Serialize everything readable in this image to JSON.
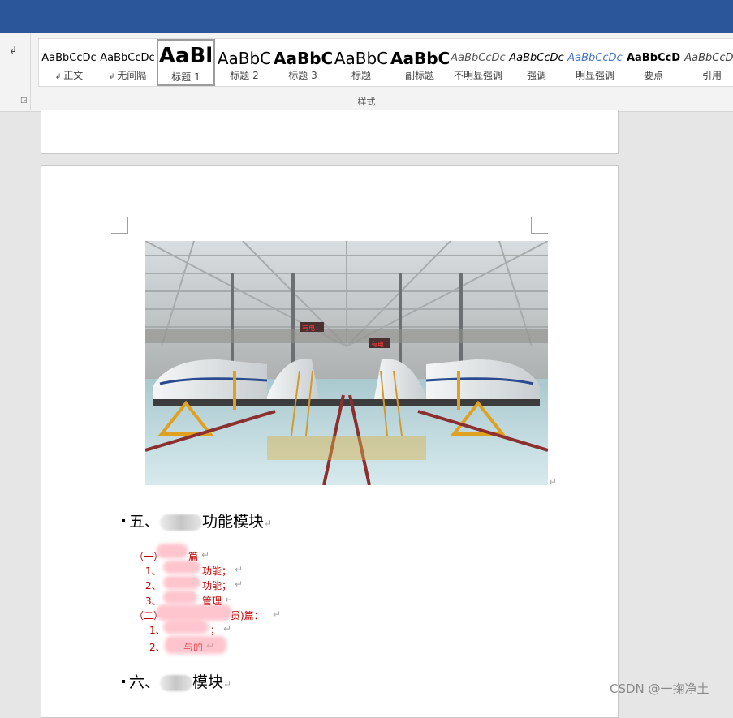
{
  "ribbon": {
    "group_label": "样式",
    "styles": [
      {
        "preview": "AaBbCcDc",
        "name": "正文",
        "mark": "↲",
        "size": 13,
        "weight": "normal",
        "italic": false,
        "color": "#000000"
      },
      {
        "preview": "AaBbCcDc",
        "name": "无间隔",
        "mark": "↲",
        "size": 13,
        "weight": "normal",
        "italic": false,
        "color": "#000000"
      },
      {
        "preview": "AaBl",
        "name": "标题 1",
        "mark": "",
        "size": 26,
        "weight": "bold",
        "italic": false,
        "color": "#000000",
        "selected": true
      },
      {
        "preview": "AaBbC",
        "name": "标题 2",
        "mark": "",
        "size": 20,
        "weight": "normal",
        "italic": false,
        "color": "#000000"
      },
      {
        "preview": "AaBbC",
        "name": "标题 3",
        "mark": "",
        "size": 20,
        "weight": "bold",
        "italic": false,
        "color": "#000000"
      },
      {
        "preview": "AaBbC",
        "name": "标题",
        "mark": "",
        "size": 20,
        "weight": "normal",
        "italic": false,
        "color": "#000000"
      },
      {
        "preview": "AaBbC",
        "name": "副标题",
        "mark": "",
        "size": 20,
        "weight": "bold",
        "italic": false,
        "color": "#000000"
      },
      {
        "preview": "AaBbCcDc",
        "name": "不明显强调",
        "mark": "",
        "size": 13,
        "weight": "normal",
        "italic": true,
        "color": "#595959"
      },
      {
        "preview": "AaBbCcDc",
        "name": "强调",
        "mark": "",
        "size": 13,
        "weight": "normal",
        "italic": true,
        "color": "#000000"
      },
      {
        "preview": "AaBbCcDc",
        "name": "明显强调",
        "mark": "",
        "size": 13,
        "weight": "normal",
        "italic": true,
        "color": "#4472c4"
      },
      {
        "preview": "AaBbCcD",
        "name": "要点",
        "mark": "",
        "size": 13,
        "weight": "bold",
        "italic": false,
        "color": "#000000"
      },
      {
        "preview": "AaBbCcDc",
        "name": "引用",
        "mark": "",
        "size": 13,
        "weight": "normal",
        "italic": true,
        "color": "#404040"
      }
    ]
  },
  "document": {
    "return_mark": "↵",
    "photo_signs": [
      "有电",
      "有电"
    ],
    "heading5": {
      "prefix": "五、",
      "suffix": "功能模块"
    },
    "heading6": {
      "prefix": "六、",
      "suffix": "模块"
    },
    "list": [
      {
        "text": "（一）",
        "tail": "篇"
      },
      {
        "text": "1、",
        "tail": "功能；"
      },
      {
        "text": "2、",
        "tail": "功能；"
      },
      {
        "text": "3、",
        "tail": "管理"
      },
      {
        "text": "（二）",
        "tail": "员)篇："
      },
      {
        "text": "1、",
        "tail": "；"
      },
      {
        "text": "2、",
        "tail": "与的"
      }
    ]
  },
  "watermark": "CSDN @一掬净土",
  "colors": {
    "title_bar": "#2b579a",
    "list_text": "#c00000"
  }
}
